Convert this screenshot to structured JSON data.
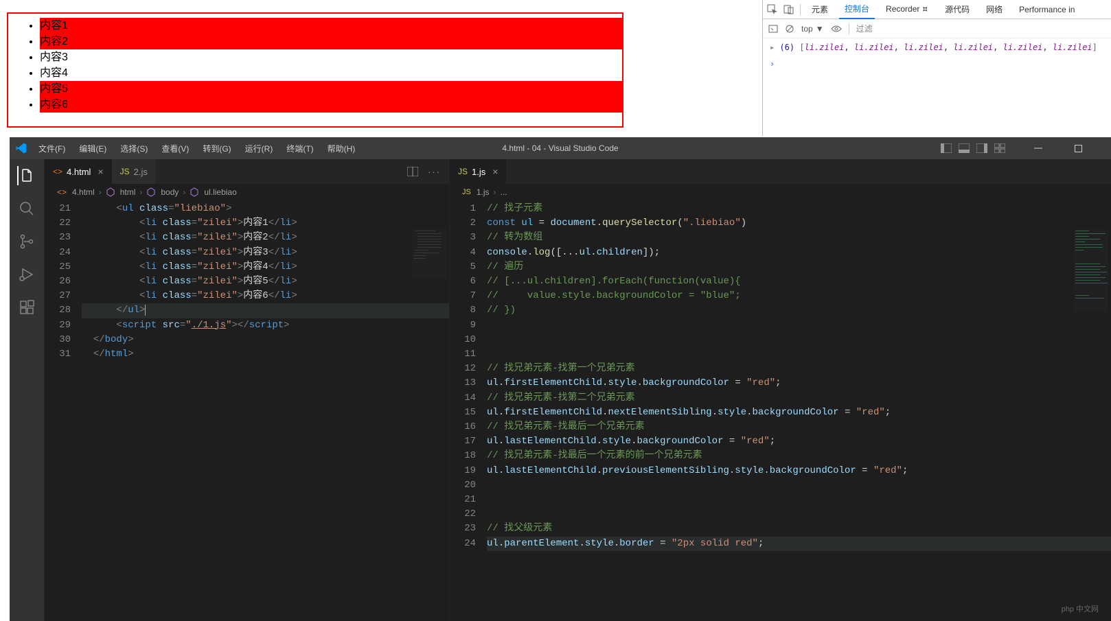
{
  "preview": {
    "items": [
      {
        "label": "内容1",
        "hl": true
      },
      {
        "label": "内容2",
        "hl": true
      },
      {
        "label": "内容3",
        "hl": false
      },
      {
        "label": "内容4",
        "hl": false
      },
      {
        "label": "内容5",
        "hl": true
      },
      {
        "label": "内容6",
        "hl": true
      }
    ]
  },
  "devtools": {
    "tabs": {
      "elements": "元素",
      "console": "控制台",
      "recorder": "Recorder ⯏",
      "sources": "源代码",
      "network": "网络",
      "performance": "Performance in"
    },
    "subbar": {
      "top": "top",
      "filter": "过滤"
    },
    "output": {
      "count": "(6)",
      "items": [
        "li.zilei",
        "li.zilei",
        "li.zilei",
        "li.zilei",
        "li.zilei",
        "li.zilei"
      ]
    }
  },
  "vscode": {
    "menu": {
      "file": "文件(F)",
      "edit": "编辑(E)",
      "select": "选择(S)",
      "view": "查看(V)",
      "go": "转到(G)",
      "run": "运行(R)",
      "terminal": "终端(T)",
      "help": "帮助(H)"
    },
    "title": "4.html - 04 - Visual Studio Code",
    "left_pane": {
      "tabs": [
        {
          "icon": "html",
          "label": "4.html",
          "active": true,
          "close": true
        },
        {
          "icon": "js",
          "label": "2.js",
          "active": false,
          "close": false
        }
      ],
      "breadcrumb": [
        "4.html",
        "html",
        "body",
        "ul.liebiao"
      ],
      "line_start": 21,
      "code_lines": [
        {
          "n": 21,
          "html": "      <span class='tok-tag'>&lt;</span><span class='tok-name'>ul</span> <span class='tok-attr'>class</span><span class='tok-tag'>=</span><span class='tok-str'>\"liebiao\"</span><span class='tok-tag'>&gt;</span>"
        },
        {
          "n": 22,
          "html": "          <span class='tok-tag'>&lt;</span><span class='tok-name'>li</span> <span class='tok-attr'>class</span><span class='tok-tag'>=</span><span class='tok-str'>\"zilei\"</span><span class='tok-tag'>&gt;</span><span class='tok-txt'>内容1</span><span class='tok-tag'>&lt;/</span><span class='tok-name'>li</span><span class='tok-tag'>&gt;</span>"
        },
        {
          "n": 23,
          "html": "          <span class='tok-tag'>&lt;</span><span class='tok-name'>li</span> <span class='tok-attr'>class</span><span class='tok-tag'>=</span><span class='tok-str'>\"zilei\"</span><span class='tok-tag'>&gt;</span><span class='tok-txt'>内容2</span><span class='tok-tag'>&lt;/</span><span class='tok-name'>li</span><span class='tok-tag'>&gt;</span>"
        },
        {
          "n": 24,
          "html": "          <span class='tok-tag'>&lt;</span><span class='tok-name'>li</span> <span class='tok-attr'>class</span><span class='tok-tag'>=</span><span class='tok-str'>\"zilei\"</span><span class='tok-tag'>&gt;</span><span class='tok-txt'>内容3</span><span class='tok-tag'>&lt;/</span><span class='tok-name'>li</span><span class='tok-tag'>&gt;</span>"
        },
        {
          "n": 25,
          "html": "          <span class='tok-tag'>&lt;</span><span class='tok-name'>li</span> <span class='tok-attr'>class</span><span class='tok-tag'>=</span><span class='tok-str'>\"zilei\"</span><span class='tok-tag'>&gt;</span><span class='tok-txt'>内容4</span><span class='tok-tag'>&lt;/</span><span class='tok-name'>li</span><span class='tok-tag'>&gt;</span>"
        },
        {
          "n": 26,
          "html": "          <span class='tok-tag'>&lt;</span><span class='tok-name'>li</span> <span class='tok-attr'>class</span><span class='tok-tag'>=</span><span class='tok-str'>\"zilei\"</span><span class='tok-tag'>&gt;</span><span class='tok-txt'>内容5</span><span class='tok-tag'>&lt;/</span><span class='tok-name'>li</span><span class='tok-tag'>&gt;</span>"
        },
        {
          "n": 27,
          "html": "          <span class='tok-tag'>&lt;</span><span class='tok-name'>li</span> <span class='tok-attr'>class</span><span class='tok-tag'>=</span><span class='tok-str'>\"zilei\"</span><span class='tok-tag'>&gt;</span><span class='tok-txt'>内容6</span><span class='tok-tag'>&lt;/</span><span class='tok-name'>li</span><span class='tok-tag'>&gt;</span>"
        },
        {
          "n": 28,
          "hl": true,
          "html": "      <span class='tok-tag'>&lt;/</span><span class='tok-name'>ul</span><span class='tok-tag'>&gt;</span><span style='border-left:1px solid #aeafad;'></span>"
        },
        {
          "n": 29,
          "html": "      <span class='tok-tag'>&lt;</span><span class='tok-name'>script</span> <span class='tok-attr'>src</span><span class='tok-tag'>=</span><span class='tok-str'>\"<span class='tok-und'>./1.js</span>\"</span><span class='tok-tag'>&gt;&lt;/</span><span class='tok-name'>script</span><span class='tok-tag'>&gt;</span>"
        },
        {
          "n": 30,
          "html": "  <span class='tok-tag'>&lt;/</span><span class='tok-name'>body</span><span class='tok-tag'>&gt;</span>"
        },
        {
          "n": 31,
          "html": "  <span class='tok-tag'>&lt;/</span><span class='tok-name'>html</span><span class='tok-tag'>&gt;</span>"
        }
      ]
    },
    "right_pane": {
      "tabs": [
        {
          "icon": "js",
          "label": "1.js",
          "active": true,
          "close": true
        }
      ],
      "breadcrumb": [
        "1.js",
        "..."
      ],
      "line_start": 1,
      "code_lines": [
        {
          "n": 1,
          "html": "<span class='tok-com'>// 找子元素</span>"
        },
        {
          "n": 2,
          "html": "<span class='tok-kw'>const</span> <span class='tok-const'>ul</span> <span class='tok-punc'>=</span> <span class='tok-var'>document</span><span class='tok-punc'>.</span><span class='tok-func'>querySelector</span><span class='tok-punc'>(</span><span class='tok-str'>\".liebiao\"</span><span class='tok-punc'>)</span>"
        },
        {
          "n": 3,
          "html": "<span class='tok-com'>// 转为数组</span>"
        },
        {
          "n": 4,
          "html": "<span class='tok-var'>console</span><span class='tok-punc'>.</span><span class='tok-func'>log</span><span class='tok-punc'>([...</span><span class='tok-var'>ul</span><span class='tok-punc'>.</span><span class='tok-prop'>children</span><span class='tok-punc'>]);</span>"
        },
        {
          "n": 5,
          "html": "<span class='tok-com'>// 遍历</span>"
        },
        {
          "n": 6,
          "html": "<span class='tok-com'>// [...ul.children].forEach(function(value){</span>"
        },
        {
          "n": 7,
          "html": "<span class='tok-com'>//     value.style.backgroundColor = \"blue\";</span>"
        },
        {
          "n": 8,
          "html": "<span class='tok-com'>// })</span>"
        },
        {
          "n": 9,
          "html": ""
        },
        {
          "n": 10,
          "html": ""
        },
        {
          "n": 11,
          "html": ""
        },
        {
          "n": 12,
          "html": "<span class='tok-com'>// 找兄弟元素-找第一个兄弟元素</span>"
        },
        {
          "n": 13,
          "html": "<span class='tok-var'>ul</span><span class='tok-punc'>.</span><span class='tok-prop'>firstElementChild</span><span class='tok-punc'>.</span><span class='tok-prop'>style</span><span class='tok-punc'>.</span><span class='tok-prop'>backgroundColor</span> <span class='tok-punc'>=</span> <span class='tok-str'>\"red\"</span><span class='tok-punc'>;</span>"
        },
        {
          "n": 14,
          "html": "<span class='tok-com'>// 找兄弟元素-找第二个兄弟元素</span>"
        },
        {
          "n": 15,
          "html": "<span class='tok-var'>ul</span><span class='tok-punc'>.</span><span class='tok-prop'>firstElementChild</span><span class='tok-punc'>.</span><span class='tok-prop'>nextElementSibling</span><span class='tok-punc'>.</span><span class='tok-prop'>style</span><span class='tok-punc'>.</span><span class='tok-prop'>backgroundColor</span> <span class='tok-punc'>=</span> <span class='tok-str'>\"red\"</span><span class='tok-punc'>;</span>"
        },
        {
          "n": 16,
          "html": "<span class='tok-com'>// 找兄弟元素-找最后一个兄弟元素</span>"
        },
        {
          "n": 17,
          "html": "<span class='tok-var'>ul</span><span class='tok-punc'>.</span><span class='tok-prop'>lastElementChild</span><span class='tok-punc'>.</span><span class='tok-prop'>style</span><span class='tok-punc'>.</span><span class='tok-prop'>backgroundColor</span> <span class='tok-punc'>=</span> <span class='tok-str'>\"red\"</span><span class='tok-punc'>;</span>"
        },
        {
          "n": 18,
          "html": "<span class='tok-com'>// 找兄弟元素-找最后一个元素的前一个兄弟元素</span>"
        },
        {
          "n": 19,
          "html": "<span class='tok-var'>ul</span><span class='tok-punc'>.</span><span class='tok-prop'>lastElementChild</span><span class='tok-punc'>.</span><span class='tok-prop'>previousElementSibling</span><span class='tok-punc'>.</span><span class='tok-prop'>style</span><span class='tok-punc'>.</span><span class='tok-prop'>backgroundColor</span> <span class='tok-punc'>=</span> <span class='tok-str'>\"red\"</span><span class='tok-punc'>;</span>"
        },
        {
          "n": 20,
          "html": ""
        },
        {
          "n": 21,
          "html": ""
        },
        {
          "n": 22,
          "html": ""
        },
        {
          "n": 23,
          "html": "<span class='tok-com'>// 找父级元素</span>"
        },
        {
          "n": 24,
          "hl": true,
          "html": "<span class='tok-var'>ul</span><span class='tok-punc'>.</span><span class='tok-prop'>parentElement</span><span class='tok-punc'>.</span><span class='tok-prop'>style</span><span class='tok-punc'>.</span><span class='tok-prop'>border</span> <span class='tok-punc'>=</span> <span class='tok-str'>\"2px solid red\"</span><span class='tok-punc'>;</span>"
        }
      ]
    }
  },
  "watermark": "php 中文网"
}
